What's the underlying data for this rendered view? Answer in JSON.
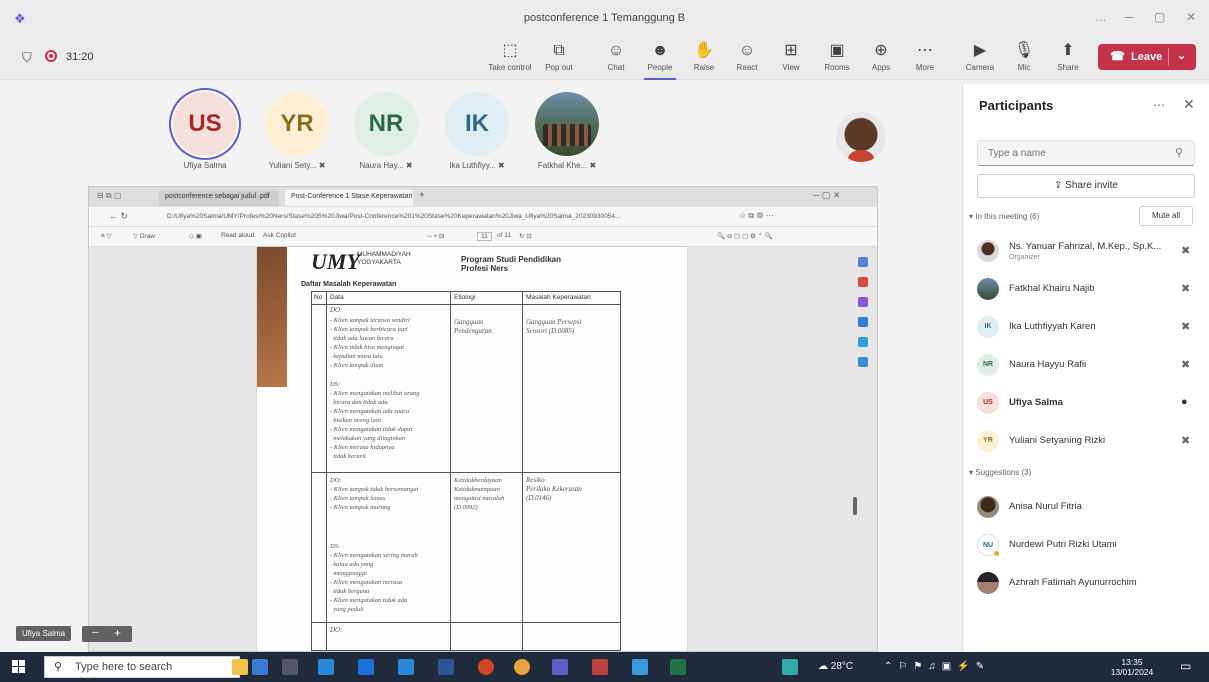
{
  "window": {
    "title": "postconference 1 Temanggung B",
    "controls": [
      "…",
      "─",
      "▢",
      "✕"
    ]
  },
  "toolbar": {
    "timer": "31:20",
    "buttons": [
      {
        "id": "take-control",
        "label": "Take control",
        "icon": "⬚"
      },
      {
        "id": "pop-out",
        "label": "Pop out",
        "icon": "⧉"
      },
      {
        "id": "chat",
        "label": "Chat",
        "icon": "☺"
      },
      {
        "id": "people",
        "label": "People",
        "icon": "☻"
      },
      {
        "id": "raise",
        "label": "Raise",
        "icon": "✋"
      },
      {
        "id": "react",
        "label": "React",
        "icon": "☺"
      },
      {
        "id": "view",
        "label": "View",
        "icon": "⊞"
      },
      {
        "id": "rooms",
        "label": "Rooms",
        "icon": "▣"
      },
      {
        "id": "apps",
        "label": "Apps",
        "icon": "⊕"
      },
      {
        "id": "more",
        "label": "More",
        "icon": "⋯"
      },
      {
        "id": "camera",
        "label": "Camera",
        "icon": "▶"
      },
      {
        "id": "mic",
        "label": "Mic",
        "icon": "🎙"
      },
      {
        "id": "share",
        "label": "Share",
        "icon": "⬆"
      }
    ],
    "leave_label": "Leave"
  },
  "stage": {
    "avatars": [
      {
        "initials": "US",
        "name": "Ufiya Salma",
        "bg": "#f3e0dc",
        "fg": "#a4262c",
        "ring": "#5b5fc7"
      },
      {
        "initials": "YR",
        "name": "Yuliani Sety...",
        "bg": "#fdf0d5",
        "fg": "#8a6d1d"
      },
      {
        "initials": "NR",
        "name": "Naura Hay...",
        "bg": "#e0efe6",
        "fg": "#2a6b46"
      },
      {
        "initials": "IK",
        "name": "Ika Luthfiyy...",
        "bg": "#e0edf3",
        "fg": "#2d6a8a"
      },
      {
        "initials": "",
        "name": "Fatkhal Khe...",
        "photo": true
      }
    ],
    "caption_name": "Ufiya Salma"
  },
  "shared_window": {
    "tabs": [
      "postconference sebagai judul .pdf",
      "Post-Conference 1 Stase Keperawatan"
    ],
    "url": "D:/Ufiya%20Salma/UMY/Profesi%20Ners/Stase%205%20Jiwa/Post-Conference%201%20Stase%20Keperawatan%20Jiwa_Ufiya%20Salma_20230930054...",
    "tools": [
      "Draw",
      "Read aloud",
      "Ask Copilot"
    ],
    "page_current": "11",
    "page_total": "of 11",
    "pdf": {
      "logo": "UMY",
      "university": "MUHAMMADIYAH YOGYAKARTA",
      "prodi": "Program Studi Pendidikan Profesi Ners",
      "section_title": "Daftar Masalah Keperawatan",
      "headers": [
        "No",
        "Data",
        "Etiologi",
        "Masalah Keperawatan"
      ],
      "ds1": "DO:",
      "hw1": "- Klien tampak tertawa sendiri\n- Klien tampak berbicara tapi\n  tidak ada lawan bicara\n- Klien tidak bisa mengingat\n  kejadian masa lalu\n- Klien tampak diam",
      "hw2": "DS:\n- Klien mengatakan melihat orang\n  bicara dan tidak ada\n- Klien mengatakan ada suara\n  bisikan orang lain\n- Klien mengatakan tidak dapat\n  melakukan yang diinginkan\n- Klien merasa hidupnya\n  tidak berarti",
      "et1": "Gangguan\nPendengaran",
      "mk1": "Gangguan Persepsi\nSensori (D.0085)",
      "hw3": "DO:\n- Klien tampak tidak bersemangat\n- Klien tampak lemas\n- Klien tampak murung",
      "et2": "Ketidakberdayaan\nKetidakmampuan\nmengatasi masalah\n(D.0092)",
      "mk2": "Resiko\nPerilaku Kekerasan\n(D.0146)",
      "hw4": "DS:\n- Klien mengatakan sering marah\n  kalau ada yang\n  mengganggu\n- Klien mengatakan merasa\n  tidak berguna\n- Klien mengatakan tidak ada\n  yang peduli",
      "do_last": "DO:"
    }
  },
  "panel": {
    "title": "Participants",
    "search_placeholder": "Type a name",
    "share_invite": "Share invite",
    "in_meeting": "In this meeting (6)",
    "mute_all": "Mute all",
    "suggestions": "Suggestions (3)",
    "participants": [
      {
        "name": "Ns. Yanuar Fahrizal, M.Kep., Sp.K...",
        "role": "Organizer",
        "avatar": "photo1",
        "initials": ""
      },
      {
        "name": "Fatkhal Khairu Najib",
        "avatar": "photo2",
        "initials": ""
      },
      {
        "name": "Ika Luthfiyyah Karen",
        "initials": "IK",
        "bg": "#e0edf3",
        "fg": "#2d6a8a"
      },
      {
        "name": "Naura Hayyu Rafii",
        "initials": "NR",
        "bg": "#e0efe6",
        "fg": "#2a6b46"
      },
      {
        "name": "Ufiya Salma",
        "initials": "US",
        "bg": "#f3e0dc",
        "fg": "#a4262c",
        "bold": true
      },
      {
        "name": "Yuliani Setyaning Rizki",
        "initials": "YR",
        "bg": "#fdf0d5",
        "fg": "#8a6d1d"
      }
    ],
    "suggested": [
      {
        "name": "Anisa Nurul Fitria",
        "avatar": "photo3",
        "initials": ""
      },
      {
        "name": "Nurdewi Putri Rizki Utami",
        "initials": "NU",
        "bg": "#ffffff",
        "fg": "#2d6a8a"
      },
      {
        "name": "Azhrah Fatimah Ayunurrochim",
        "avatar": "photo4",
        "initials": ""
      }
    ]
  },
  "taskbar": {
    "search_placeholder": "Type here to search",
    "weather": "28°C",
    "time": "13:35",
    "date": "13/01/2024"
  }
}
